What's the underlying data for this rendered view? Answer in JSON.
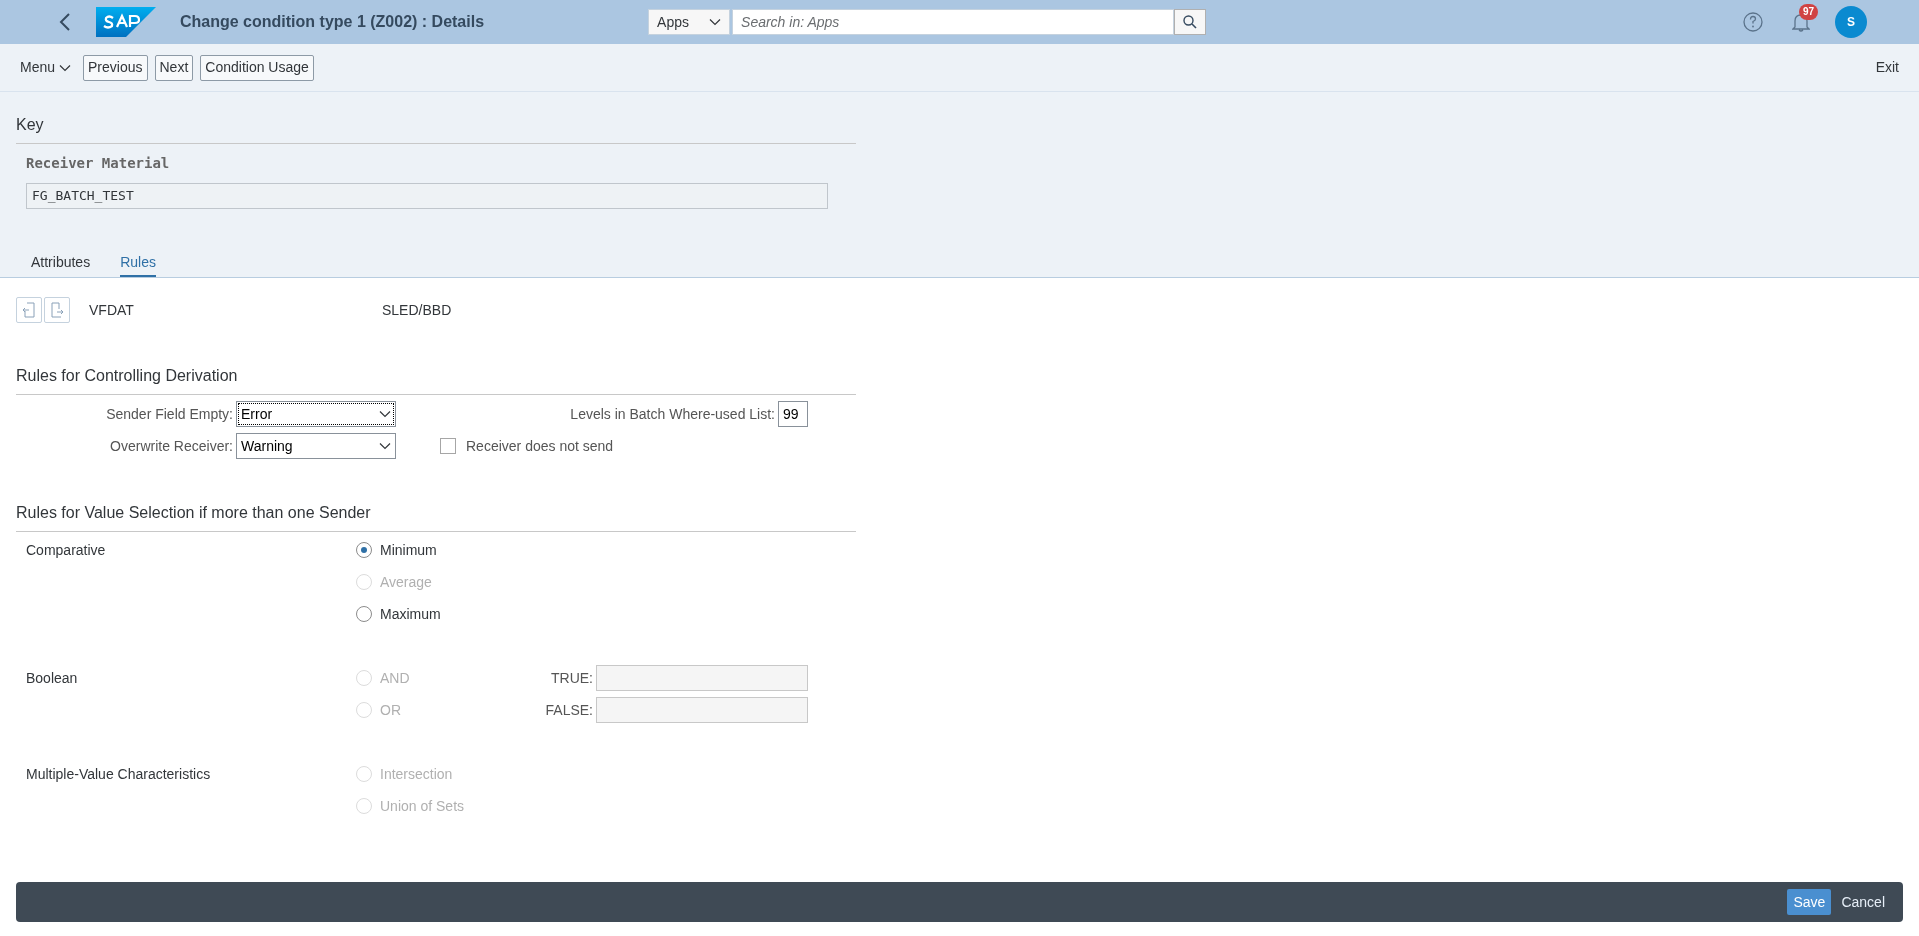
{
  "header": {
    "title": "Change condition type 1 (Z002) : Details",
    "search_scope": "Apps",
    "search_placeholder": "Search in: Apps",
    "notification_count": "97",
    "avatar": "S"
  },
  "toolbar": {
    "menu": "Menu",
    "buttons": [
      "Previous",
      "Next",
      "Condition Usage"
    ],
    "exit": "Exit"
  },
  "key": {
    "title": "Key",
    "field_label": "Receiver Material",
    "field_value": "FG_BATCH_TEST"
  },
  "tabs": [
    {
      "label": "Attributes",
      "selected": false
    },
    {
      "label": "Rules",
      "selected": true
    }
  ],
  "field_row": {
    "name": "VFDAT",
    "description": "SLED/BBD"
  },
  "derivation": {
    "title": "Rules for Controlling Derivation",
    "dropdowns": [
      {
        "label": "Sender Field Empty:",
        "value": "Error",
        "focused": true
      },
      {
        "label": "Overwrite Receiver:",
        "value": "Warning",
        "focused": false
      }
    ],
    "levels": {
      "label": "Levels in Batch Where-used List:",
      "value": "99"
    },
    "checkbox": {
      "label": "Receiver does not send",
      "checked": false
    }
  },
  "value_selection": {
    "title": "Rules for Value Selection if more than one Sender",
    "groups": [
      {
        "label": "Comparative",
        "options": [
          {
            "label": "Minimum",
            "selected": true,
            "disabled": false
          },
          {
            "label": "Average",
            "selected": false,
            "disabled": true
          },
          {
            "label": "Maximum",
            "selected": false,
            "disabled": false
          }
        ]
      },
      {
        "label": "Boolean",
        "options": [
          {
            "label": "AND",
            "selected": false,
            "disabled": true
          },
          {
            "label": "OR",
            "selected": false,
            "disabled": true
          }
        ],
        "fields": [
          {
            "label": "TRUE:"
          },
          {
            "label": "FALSE:"
          }
        ]
      },
      {
        "label": "Multiple-Value Characteristics",
        "options": [
          {
            "label": "Intersection",
            "selected": false,
            "disabled": true
          },
          {
            "label": "Union of Sets",
            "selected": false,
            "disabled": true
          }
        ]
      }
    ]
  },
  "footer": {
    "buttons": [
      "Save",
      "Cancel"
    ]
  }
}
